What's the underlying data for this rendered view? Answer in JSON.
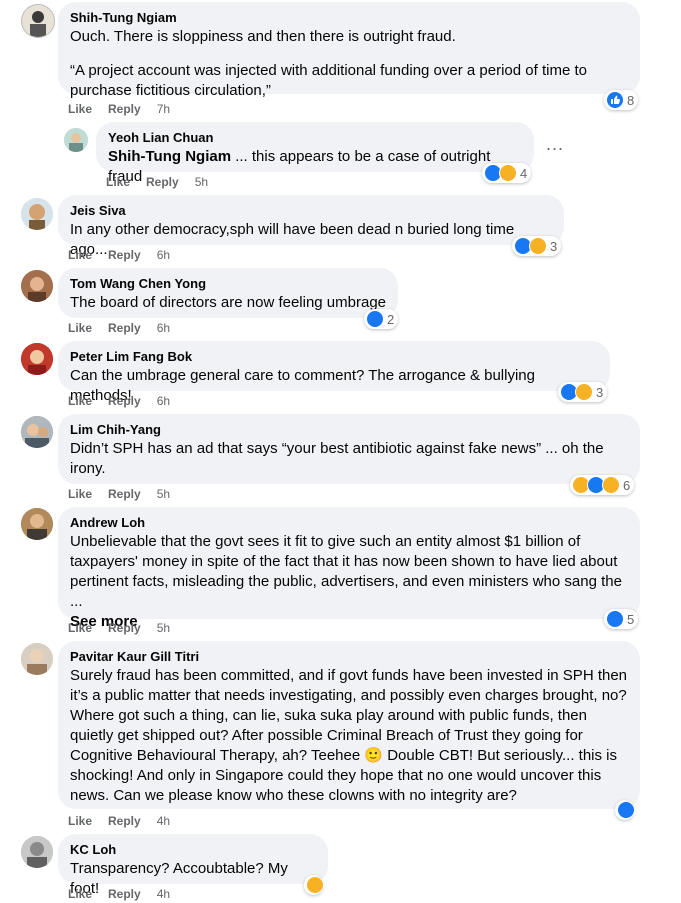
{
  "comments": [
    {
      "author": "Shih-Tung Ngiam",
      "lines": [
        "Ouch. There is sloppiness and then there is outright fraud.",
        "“A project account was injected with additional funding over a period of time to purchase fictitious circulation,”"
      ],
      "like": "Like",
      "reply": "Reply",
      "time": "7h",
      "reactions": {
        "count": "8"
      }
    },
    {
      "author": "Yeoh Lian Chuan",
      "mention": "Shih-Tung Ngiam",
      "text": " ... this appears to be a case of outright fraud",
      "like": "Like",
      "reply": "Reply",
      "time": "5h",
      "reactions": {
        "count": "4"
      },
      "more": "..."
    },
    {
      "author": "Jeis Siva",
      "text": "In any other democracy,sph will have been dead n buried long time ago...",
      "like": "Like",
      "reply": "Reply",
      "time": "6h",
      "reactions": {
        "count": "3"
      }
    },
    {
      "author": "Tom Wang Chen Yong",
      "text": "The board of directors are now feeling umbrage",
      "like": "Like",
      "reply": "Reply",
      "time": "6h",
      "reactions": {
        "count": "2"
      }
    },
    {
      "author": "Peter Lim Fang Bok",
      "text": "Can the umbrage general care to comment? The arrogance & bullying methods!",
      "like": "Like",
      "reply": "Reply",
      "time": "6h",
      "reactions": {
        "count": "3"
      }
    },
    {
      "author": "Lim Chih-Yang",
      "text": "Didn’t SPH has an ad that says “your best antibiotic against fake news” ... oh the irony.",
      "like": "Like",
      "reply": "Reply",
      "time": "5h",
      "reactions": {
        "count": "6"
      }
    },
    {
      "author": "Andrew Loh",
      "text": "Unbelievable that the govt sees it fit to give such an entity almost $1 billion of taxpayers' money in spite of the fact that it has now been shown to have lied about pertinent facts, misleading the public, advertisers, and even ministers who sang the ...",
      "see_more": "See more",
      "like": "Like",
      "reply": "Reply",
      "time": "5h",
      "reactions": {
        "count": "5"
      }
    },
    {
      "author": "Pavitar Kaur Gill Titri",
      "text": "Surely fraud has been committed, and if govt funds have been invested in SPH then it’s a public matter that needs investigating, and possibly even charges brought, no? Where got such a thing, can lie, suka suka play around with public funds, then quietly get shipped out? After possible Criminal Breach of Trust they going for Cognitive Behavioural Therapy, ah? Teehee 🙂 Double CBT! But seriously... this is shocking! And only in Singapore could they hope that no one would uncover this news. Can we please know who these clowns with no integrity are?",
      "like": "Like",
      "reply": "Reply",
      "time": "4h",
      "reactions": {
        "count": ""
      }
    },
    {
      "author": "KC Loh",
      "text": "Transparency? Accoubtable? My foot!",
      "like": "Like",
      "reply": "Reply",
      "time": "4h",
      "reactions": {
        "count": ""
      }
    }
  ]
}
